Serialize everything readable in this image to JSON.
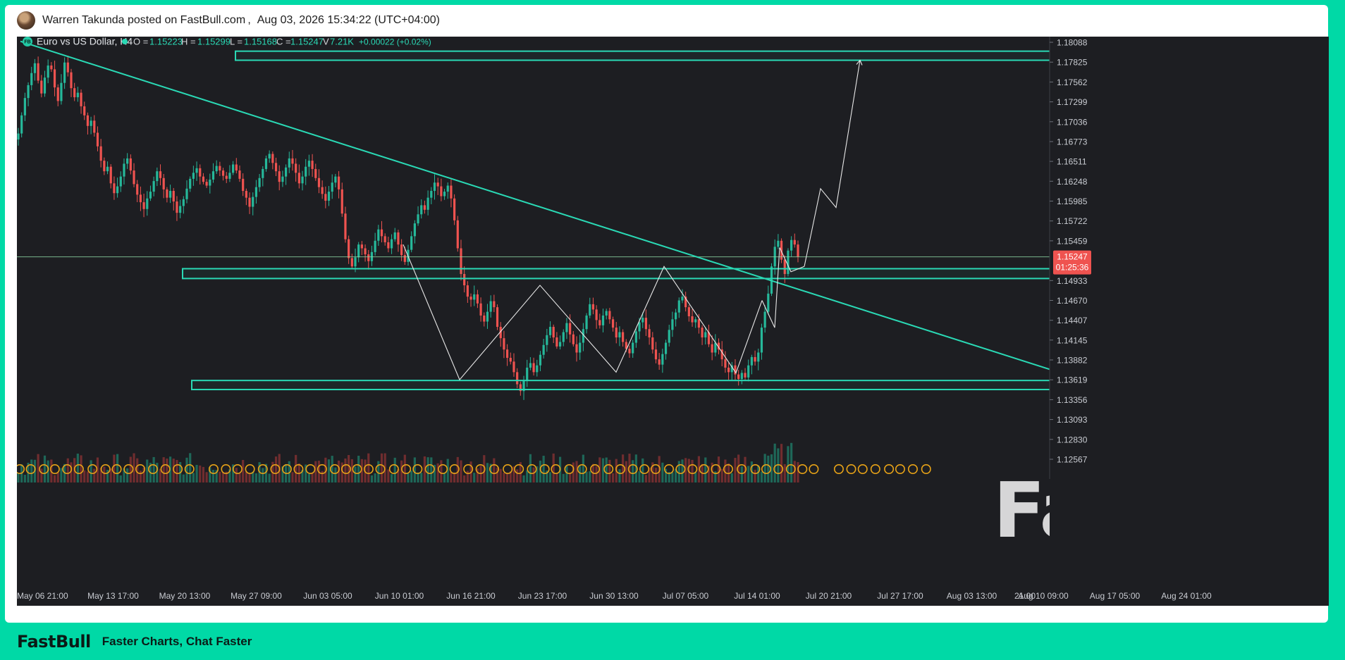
{
  "post": {
    "author_line": "Warren Takunda posted on FastBull.com ,  Aug 03, 2026 15:34:22 (UTC+04:00)"
  },
  "footer": {
    "logo": "FastBull",
    "tagline": "Faster Charts, Chat Faster"
  },
  "watermark": "FastBull",
  "colors": {
    "frame": "#00d9a6",
    "chart_bg": "#1d1e22",
    "up": "#26b89a",
    "down": "#ef5350",
    "zone": "#2ad9b5",
    "price_tag": "#ef5350",
    "event_badge": "#e8a317"
  },
  "chart_data": {
    "type": "candlestick",
    "symbol_badge": "FB",
    "title": "Euro vs US Dollar, H4",
    "ohlc": {
      "o_label": "O =",
      "o": "1.15223",
      "h_label": "H =",
      "h": "1.15299",
      "l_label": "L =",
      "l": "1.15168",
      "c_label": "C =",
      "c": "1.15247",
      "v_label": "V",
      "v": "7.21K",
      "change": "+0.00022 (+0.02%)"
    },
    "y_ticks": [
      "1.18088",
      "1.17825",
      "1.17562",
      "1.17299",
      "1.17036",
      "1.16773",
      "1.16511",
      "1.16248",
      "1.15985",
      "1.15722",
      "1.15459",
      "1.14933",
      "1.14670",
      "1.14407",
      "1.14145",
      "1.13882",
      "1.13619",
      "1.13356",
      "1.13093",
      "1.12830",
      "1.12567"
    ],
    "ylim": [
      1.12567,
      1.18088
    ],
    "x_ticks": [
      "May 06 21:00",
      "May 13 17:00",
      "May 20 13:00",
      "May 27 09:00",
      "Jun 03 05:00",
      "Jun 10 01:00",
      "Jun 16 21:00",
      "Jun 23 17:00",
      "Jun 30 13:00",
      "Jul 07 05:00",
      "Jul 14 01:00",
      "Jul 20 21:00",
      "Jul 27 17:00",
      "Aug 03 13:00",
      "Aug 10 09:00",
      "Aug 17 05:00",
      "Aug 24 01:00",
      "21:00"
    ],
    "current_price": {
      "price": "1.15247",
      "countdown": "01:25:36"
    },
    "zones": [
      {
        "from": 1.1785,
        "to": 1.1797
      },
      {
        "from": 1.1496,
        "to": 1.1509
      },
      {
        "from": 1.1349,
        "to": 1.1361
      }
    ],
    "trendline": [
      {
        "date": "May 06 21:00",
        "price": 1.181
      },
      {
        "date": "Aug 24 01:00",
        "price": 1.1327
      }
    ],
    "path": [
      1.1783,
      1.1675,
      1.1697,
      1.1615,
      1.1627,
      1.1603,
      1.1517,
      1.1555,
      1.1507,
      1.1615,
      1.1535,
      1.1559,
      1.1624,
      1.1516
    ],
    "projection": [
      1.1512,
      1.1615,
      1.159,
      1.1785
    ],
    "closes": [
      1.1688,
      1.1712,
      1.1735,
      1.1752,
      1.1768,
      1.1781,
      1.1758,
      1.1741,
      1.1762,
      1.1778,
      1.1773,
      1.1749,
      1.1731,
      1.1755,
      1.1782,
      1.1769,
      1.1748,
      1.1736,
      1.1742,
      1.1724,
      1.1712,
      1.1698,
      1.1705,
      1.1689,
      1.1671,
      1.1652,
      1.1638,
      1.1644,
      1.1622,
      1.1609,
      1.1618,
      1.1631,
      1.1648,
      1.1655,
      1.1639,
      1.1621,
      1.1607,
      1.1597,
      1.1588,
      1.1602,
      1.1611,
      1.1625,
      1.1638,
      1.1629,
      1.1614,
      1.1603,
      1.1612,
      1.1598,
      1.1583,
      1.1592,
      1.1601,
      1.1615,
      1.1628,
      1.1636,
      1.1642,
      1.1631,
      1.1624,
      1.1619,
      1.1627,
      1.1638,
      1.1645,
      1.1639,
      1.1632,
      1.1628,
      1.1636,
      1.1647,
      1.1639,
      1.1628,
      1.1612,
      1.1603,
      1.1591,
      1.1604,
      1.1617,
      1.1629,
      1.1641,
      1.1655,
      1.1661,
      1.1649,
      1.1638,
      1.1624,
      1.1631,
      1.1643,
      1.1655,
      1.1648,
      1.1636,
      1.1622,
      1.1631,
      1.1644,
      1.1652,
      1.1641,
      1.1629,
      1.1617,
      1.1608,
      1.1599,
      1.1611,
      1.1623,
      1.1631,
      1.1614,
      1.1582,
      1.1548,
      1.1523,
      1.1512,
      1.1524,
      1.1541,
      1.1536,
      1.1528,
      1.1519,
      1.1531,
      1.1546,
      1.1561,
      1.1552,
      1.1544,
      1.1536,
      1.1548,
      1.1557,
      1.1541,
      1.1527,
      1.1518,
      1.1534,
      1.1552,
      1.1569,
      1.1581,
      1.1593,
      1.1587,
      1.1603,
      1.1612,
      1.1623,
      1.1618,
      1.1605,
      1.1611,
      1.1619,
      1.1602,
      1.1573,
      1.1536,
      1.1502,
      1.1487,
      1.1472,
      1.1468,
      1.1475,
      1.1463,
      1.1447,
      1.1439,
      1.1452,
      1.1466,
      1.1458,
      1.1432,
      1.1417,
      1.1402,
      1.1391,
      1.1386,
      1.1372,
      1.1356,
      1.1347,
      1.1361,
      1.1378,
      1.1384,
      1.1372,
      1.1381,
      1.1395,
      1.1408,
      1.1421,
      1.1432,
      1.1418,
      1.1406,
      1.1412,
      1.1425,
      1.1437,
      1.1422,
      1.1409,
      1.1398,
      1.1411,
      1.1429,
      1.1447,
      1.1462,
      1.1455,
      1.1441,
      1.1434,
      1.1447,
      1.1453,
      1.1442,
      1.1431,
      1.1418,
      1.1425,
      1.1412,
      1.1403,
      1.1397,
      1.1411,
      1.1426,
      1.1438,
      1.1444,
      1.1429,
      1.1418,
      1.1402,
      1.1389,
      1.1382,
      1.1396,
      1.1411,
      1.1428,
      1.1442,
      1.1451,
      1.1467,
      1.1472,
      1.1458,
      1.1446,
      1.1438,
      1.1442,
      1.1431,
      1.1418,
      1.1425,
      1.1409,
      1.1398,
      1.1411,
      1.1402,
      1.1389,
      1.1378,
      1.1372,
      1.1381,
      1.1369,
      1.1363,
      1.1371,
      1.1365,
      1.1381,
      1.1392,
      1.1386,
      1.1398,
      1.1431,
      1.1452,
      1.1476,
      1.1512,
      1.1538,
      1.1546,
      1.1521,
      1.1502,
      1.1533,
      1.1547,
      1.1541,
      1.15247
    ]
  }
}
